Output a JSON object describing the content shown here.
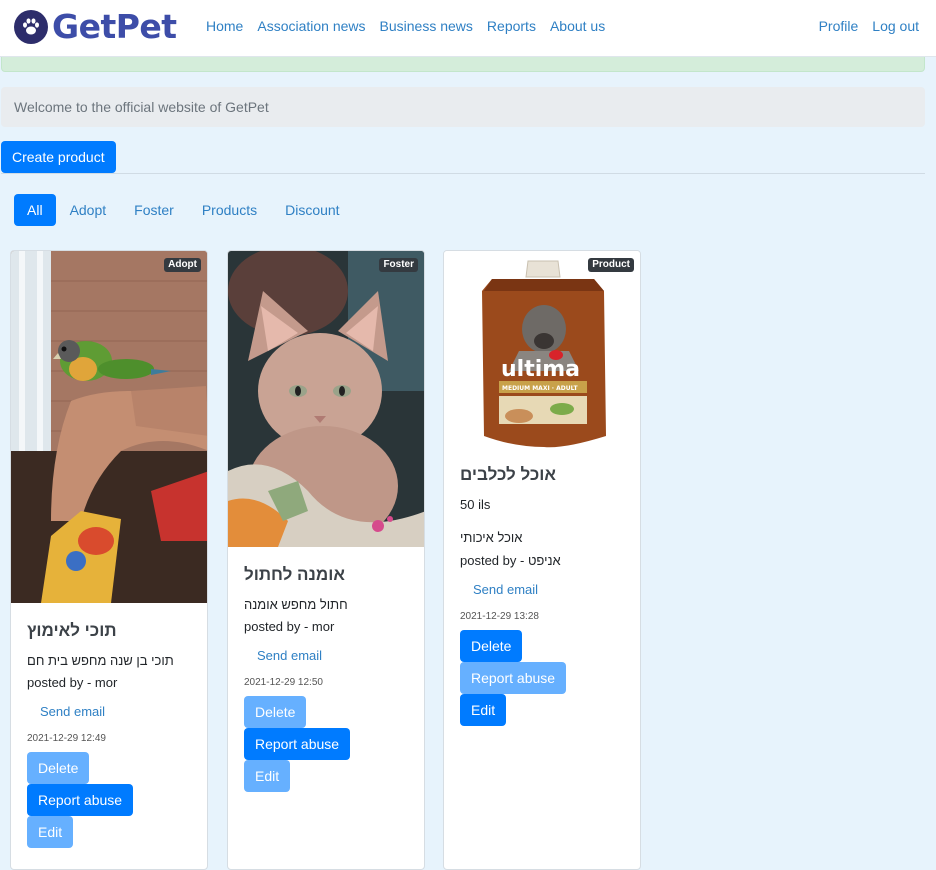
{
  "navbar": {
    "brand": "GetPet",
    "links": [
      "Home",
      "Association news",
      "Business news",
      "Reports",
      "About us"
    ],
    "right_links": [
      "Profile",
      "Log out"
    ]
  },
  "jumbotron": {
    "text": "Welcome to the official website of GetPet"
  },
  "create_button": "Create product",
  "filters": [
    "All",
    "Adopt",
    "Foster",
    "Products",
    "Discount"
  ],
  "active_filter": "All",
  "cards": [
    {
      "badge": "Adopt",
      "title": "תוכי לאימוץ",
      "description": "תוכי בן שנה מחפש בית חם",
      "posted_by": "posted by - mor",
      "send_email": "Send email",
      "date": "2021-12-29 12:49",
      "buttons": [
        "Delete",
        "Report abuse",
        "Edit"
      ]
    },
    {
      "badge": "Foster",
      "title": "אומנה לחתול",
      "description": "חתול מחפש אומנה",
      "posted_by": "posted by - mor",
      "send_email": "Send email",
      "date": "2021-12-29 12:50",
      "buttons": [
        "Delete",
        "Report abuse",
        "Edit"
      ]
    },
    {
      "badge": "Product",
      "title": "אוכל לכלבים",
      "price": "50 ils",
      "description": "אוכל איכותי",
      "posted_by": "posted by - אניפט",
      "send_email": "Send email",
      "date": "2021-12-29 13:28",
      "buttons": [
        "Delete",
        "Report abuse",
        "Edit"
      ],
      "package_brand": "ultima",
      "package_label": "MEDIUM MAXI · ADULT"
    }
  ],
  "icons": {
    "logo": "paw-icon"
  },
  "colors": {
    "primary": "#007bff",
    "primary_light": "#66b0ff",
    "brand": "#3d4da8",
    "page_bg": "#e7f3fc"
  }
}
